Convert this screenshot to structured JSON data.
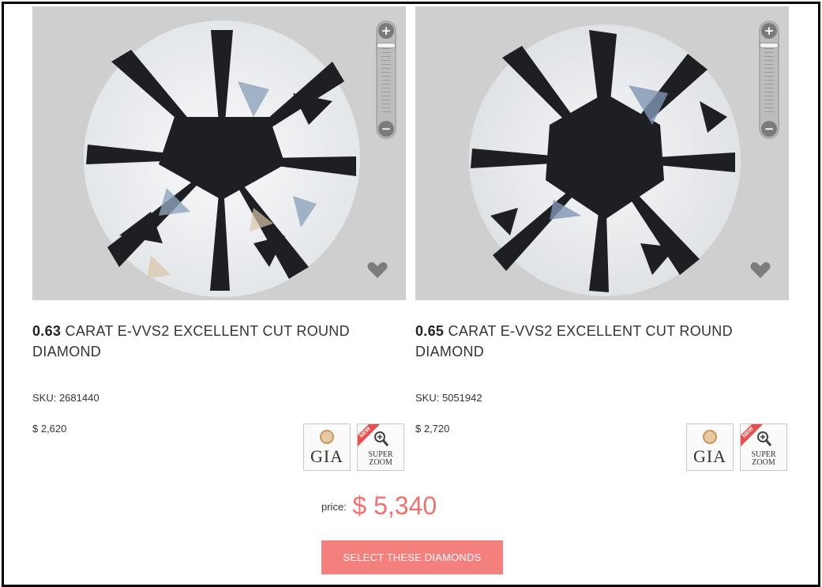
{
  "products": [
    {
      "carat": "0.63",
      "title_rest": "CARAT E-VVS2 EXCELLENT CUT ROUND DIAMOND",
      "sku": "SKU: 2681440",
      "price": "$ 2,620"
    },
    {
      "carat": "0.65",
      "title_rest": "CARAT E-VVS2 EXCELLENT CUT ROUND DIAMOND",
      "sku": "SKU: 5051942",
      "price": "$ 2,720"
    }
  ],
  "zoom": {
    "plus": "+",
    "minus": "−"
  },
  "badges": {
    "gia": "GIA",
    "new": "NEW",
    "super": "SUPER",
    "zoom": "ZOOM"
  },
  "total": {
    "label": "price:",
    "amount": "$ 5,340"
  },
  "cta": {
    "label": "SELECT THESE DIAMONDS"
  },
  "colors": {
    "accent": "#f3807d",
    "price": "#f07270",
    "image_bg": "#cfcfcf"
  }
}
